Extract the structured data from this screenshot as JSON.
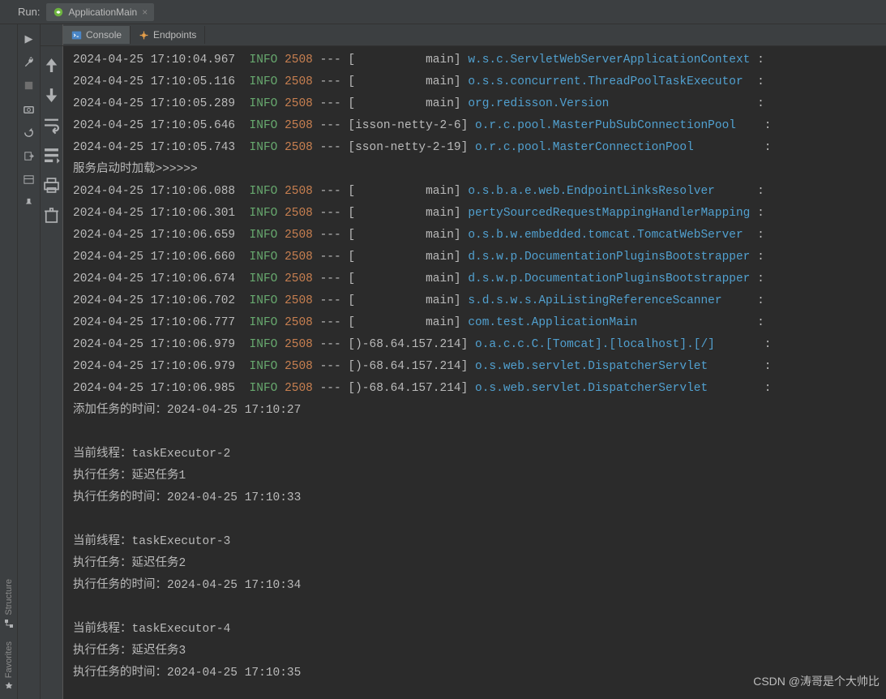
{
  "runLabel": "Run:",
  "appTab": {
    "label": "ApplicationMain"
  },
  "subTabs": {
    "console": "Console",
    "endpoints": "Endpoints"
  },
  "railBottom": {
    "structure": "Structure",
    "favorites": "Favorites"
  },
  "logs": [
    {
      "ts": "2024-04-25 17:10:04.967",
      "level": "INFO",
      "pid": "2508",
      "thread": "[          main]",
      "logger": "w.s.c.ServletWebServerApplicationContext",
      "colon": " :"
    },
    {
      "ts": "2024-04-25 17:10:05.116",
      "level": "INFO",
      "pid": "2508",
      "thread": "[          main]",
      "logger": "o.s.s.concurrent.ThreadPoolTaskExecutor ",
      "colon": " :"
    },
    {
      "ts": "2024-04-25 17:10:05.289",
      "level": "INFO",
      "pid": "2508",
      "thread": "[          main]",
      "logger": "org.redisson.Version                    ",
      "colon": " :"
    },
    {
      "ts": "2024-04-25 17:10:05.646",
      "level": "INFO",
      "pid": "2508",
      "thread": "[isson-netty-2-6]",
      "logger": "o.r.c.pool.MasterPubSubConnectionPool   ",
      "colon": " :"
    },
    {
      "ts": "2024-04-25 17:10:05.743",
      "level": "INFO",
      "pid": "2508",
      "thread": "[sson-netty-2-19]",
      "logger": "o.r.c.pool.MasterConnectionPool         ",
      "colon": " :"
    }
  ],
  "plain1": "服务启动时加载>>>>>>",
  "logs2": [
    {
      "ts": "2024-04-25 17:10:06.088",
      "level": "INFO",
      "pid": "2508",
      "thread": "[          main]",
      "logger": "o.s.b.a.e.web.EndpointLinksResolver     ",
      "colon": " :"
    },
    {
      "ts": "2024-04-25 17:10:06.301",
      "level": "INFO",
      "pid": "2508",
      "thread": "[          main]",
      "logger": "pertySourcedRequestMappingHandlerMapping",
      "colon": " :"
    },
    {
      "ts": "2024-04-25 17:10:06.659",
      "level": "INFO",
      "pid": "2508",
      "thread": "[          main]",
      "logger": "o.s.b.w.embedded.tomcat.TomcatWebServer ",
      "colon": " :"
    },
    {
      "ts": "2024-04-25 17:10:06.660",
      "level": "INFO",
      "pid": "2508",
      "thread": "[          main]",
      "logger": "d.s.w.p.DocumentationPluginsBootstrapper",
      "colon": " :"
    },
    {
      "ts": "2024-04-25 17:10:06.674",
      "level": "INFO",
      "pid": "2508",
      "thread": "[          main]",
      "logger": "d.s.w.p.DocumentationPluginsBootstrapper",
      "colon": " :"
    },
    {
      "ts": "2024-04-25 17:10:06.702",
      "level": "INFO",
      "pid": "2508",
      "thread": "[          main]",
      "logger": "s.d.s.w.s.ApiListingReferenceScanner    ",
      "colon": " :"
    },
    {
      "ts": "2024-04-25 17:10:06.777",
      "level": "INFO",
      "pid": "2508",
      "thread": "[          main]",
      "logger": "com.test.ApplicationMain                ",
      "colon": " :"
    },
    {
      "ts": "2024-04-25 17:10:06.979",
      "level": "INFO",
      "pid": "2508",
      "thread": "[)-68.64.157.214]",
      "logger": "o.a.c.c.C.[Tomcat].[localhost].[/]      ",
      "colon": " :"
    },
    {
      "ts": "2024-04-25 17:10:06.979",
      "level": "INFO",
      "pid": "2508",
      "thread": "[)-68.64.157.214]",
      "logger": "o.s.web.servlet.DispatcherServlet       ",
      "colon": " :"
    },
    {
      "ts": "2024-04-25 17:10:06.985",
      "level": "INFO",
      "pid": "2508",
      "thread": "[)-68.64.157.214]",
      "logger": "o.s.web.servlet.DispatcherServlet       ",
      "colon": " :"
    }
  ],
  "plainLines": [
    "添加任务的时间：2024-04-25 17:10:27",
    "",
    "当前线程：taskExecutor-2",
    "执行任务：延迟任务1",
    "执行任务的时间：2024-04-25 17:10:33",
    "",
    "当前线程：taskExecutor-3",
    "执行任务：延迟任务2",
    "执行任务的时间：2024-04-25 17:10:34",
    "",
    "当前线程：taskExecutor-4",
    "执行任务：延迟任务3",
    "执行任务的时间：2024-04-25 17:10:35"
  ],
  "watermark": "CSDN @涛哥是个大帅比"
}
